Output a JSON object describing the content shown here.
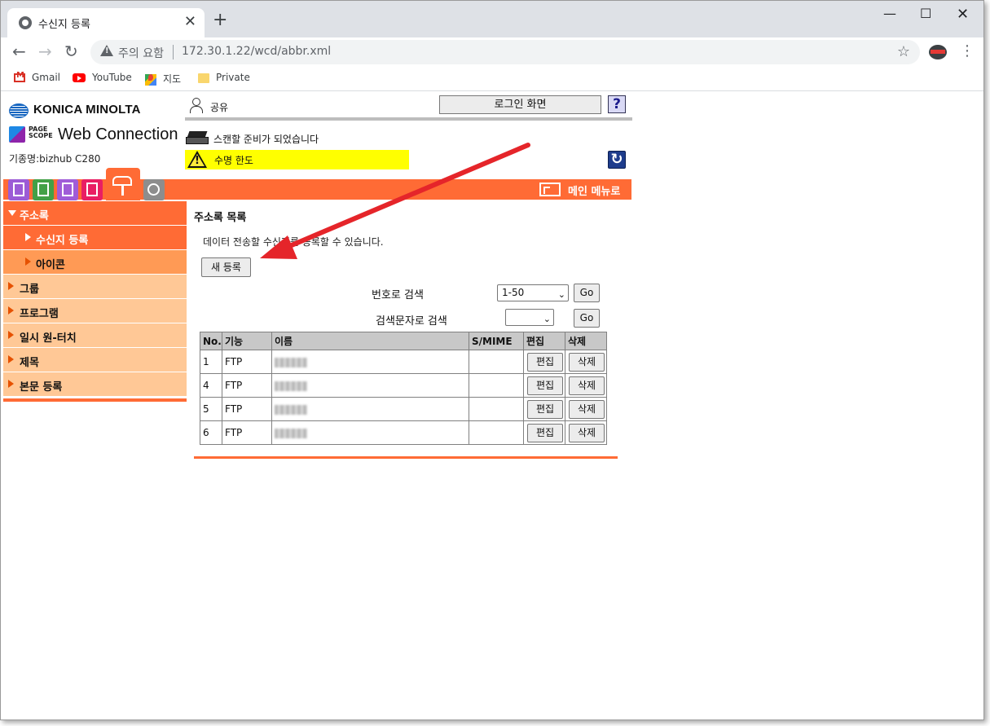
{
  "browser": {
    "tab_title": "수신지 등록",
    "new_tab": "+",
    "close_tab": "✕",
    "window_min": "—",
    "window_max": "☐",
    "window_close": "✕",
    "omnibox_status": "주의 요함",
    "url": "172.30.1.22/wcd/abbr.xml",
    "bookmarks": [
      "Gmail",
      "YouTube",
      "지도",
      "Private"
    ]
  },
  "header": {
    "brand": "KONICA MINOLTA",
    "product_small": "PAGE\nSCOPE",
    "product": "Web Connection",
    "model": "기종명:bizhub C280",
    "user": "공유",
    "login_button": "로그인 화면",
    "help_button": "?",
    "status_scan": "스캔할 준비가 되었습니다",
    "status_warning": "수명 한도",
    "main_menu": "메인 메뉴로"
  },
  "sidebar": {
    "top": "주소록",
    "items": [
      {
        "label": "수신지 등록",
        "level": "sub",
        "active": true
      },
      {
        "label": "아이콘",
        "level": "sub",
        "active": false
      },
      {
        "label": "그룹",
        "level": "group",
        "active": false
      },
      {
        "label": "프로그램",
        "level": "group",
        "active": false
      },
      {
        "label": "일시 원-터치",
        "level": "group",
        "active": false
      },
      {
        "label": "제목",
        "level": "group",
        "active": false
      },
      {
        "label": "본문 등록",
        "level": "group",
        "active": false
      }
    ]
  },
  "main": {
    "section_title": "주소록 목록",
    "description": "데이터 전송할 수신지를 등록할 수 있습니다.",
    "new_button": "새 등록",
    "search_by_number_label": "번호로 검색",
    "search_by_number_value": "1-50",
    "search_by_char_label": "검색문자로 검색",
    "search_by_char_value": "",
    "go_label": "Go"
  },
  "table": {
    "columns": [
      "No.",
      "기능",
      "이름",
      "S/MIME",
      "편집",
      "삭제"
    ],
    "rows": [
      {
        "no": "1",
        "function": "FTP"
      },
      {
        "no": "4",
        "function": "FTP"
      },
      {
        "no": "5",
        "function": "FTP"
      },
      {
        "no": "6",
        "function": "FTP"
      }
    ],
    "edit_label": "편집",
    "delete_label": "삭제"
  },
  "colors": {
    "accent": "#ff6b35",
    "sidebar_sub": "#ff9a55",
    "sidebar_group": "#ffc896",
    "warning_bg": "#ffff00",
    "annotation_arrow": "#e5252a"
  }
}
